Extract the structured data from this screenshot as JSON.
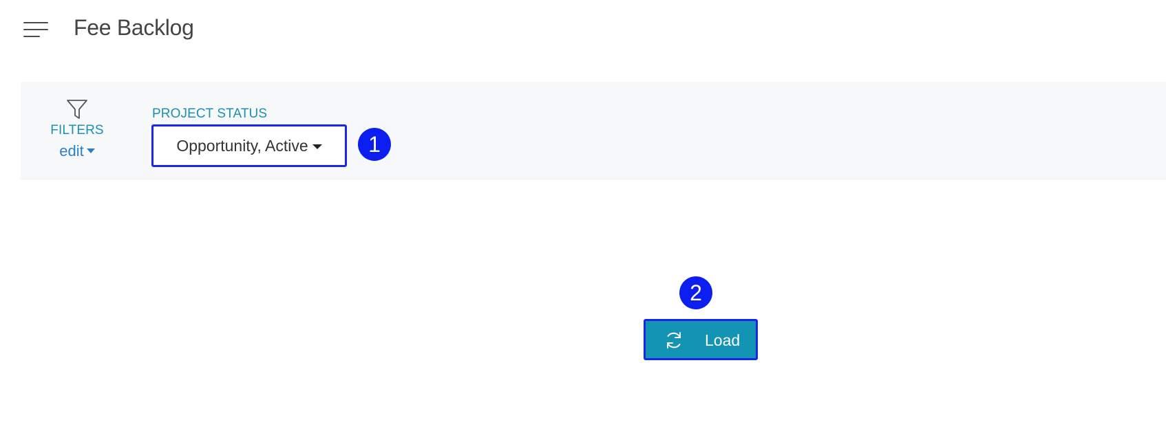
{
  "header": {
    "title": "Fee Backlog",
    "menu_icon": "hamburger-menu-icon"
  },
  "filters": {
    "icon": "filter-icon",
    "label": "FILTERS",
    "edit_label": "edit"
  },
  "project_status": {
    "label": "PROJECT STATUS",
    "selected": "Opportunity, Active"
  },
  "load_button": {
    "icon": "refresh-icon",
    "label": "Load"
  },
  "markers": [
    "1",
    "2"
  ],
  "colors": {
    "accent_teal": "#1494b5",
    "label_teal": "#1e8fae",
    "link_blue": "#2b7fc9",
    "highlight_blue": "#1726e8",
    "marker_blue": "#0d1ff0",
    "filter_bar_bg": "#f7f8fa"
  }
}
